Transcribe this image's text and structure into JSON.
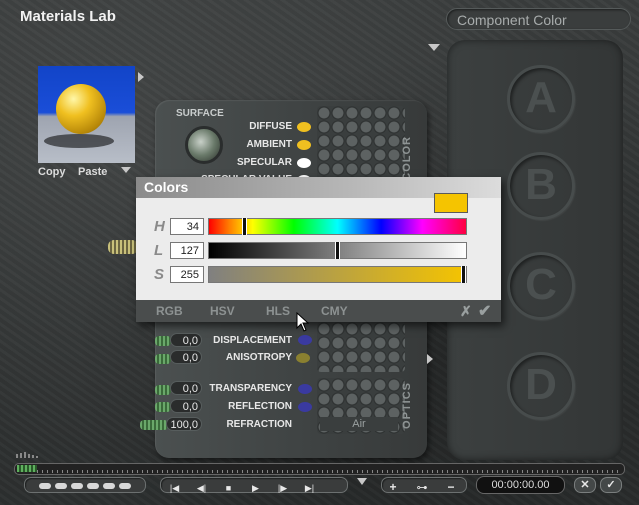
{
  "app": {
    "title": "Materials Lab",
    "component_field": "Component Color"
  },
  "slots": [
    "A",
    "B",
    "C",
    "D"
  ],
  "preview": {
    "copy_label": "Copy",
    "paste_label": "Paste"
  },
  "surface": {
    "heading": "SURFACE",
    "side_label": "COLOR",
    "items": [
      {
        "label": "DIFFUSE",
        "dot_color": "#f0c020"
      },
      {
        "label": "AMBIENT",
        "dot_color": "#f0c020"
      },
      {
        "label": "SPECULAR",
        "dot_color": "#ffffff"
      },
      {
        "label": "SPECULAR VALUE",
        "dot_color": "#ffffff"
      }
    ]
  },
  "bump": {
    "items": [
      {
        "value": "0,0",
        "label": "DISPLACEMENT",
        "dot_color": "#3a3aa0"
      },
      {
        "value": "0,0",
        "label": "ANISOTROPY",
        "dot_color": "#8a8030"
      }
    ]
  },
  "optics": {
    "side_label": "OPTICS",
    "items": [
      {
        "value": "0,0",
        "label": "TRANSPARENCY",
        "dot_color": "#3a3aa0"
      },
      {
        "value": "0,0",
        "label": "REFLECTION",
        "dot_color": "#3a3aa0"
      },
      {
        "value": "100,0",
        "label": "REFRACTION"
      }
    ],
    "refraction_medium": "Air"
  },
  "colors_dialog": {
    "title": "Colors",
    "swatch_color": "#f5c400",
    "channels": [
      {
        "name": "H",
        "value": "34",
        "position": 0.13
      },
      {
        "name": "L",
        "value": "127",
        "position": 0.5
      },
      {
        "name": "S",
        "value": "255",
        "position": 1.0
      }
    ],
    "modes": [
      "RGB",
      "HSV",
      "HLS",
      "CMY"
    ],
    "active_mode": "HLS",
    "cancel_icon": "x-icon",
    "ok_icon": "check-icon"
  },
  "timeline": {
    "timecode": "00:00:00.00"
  }
}
